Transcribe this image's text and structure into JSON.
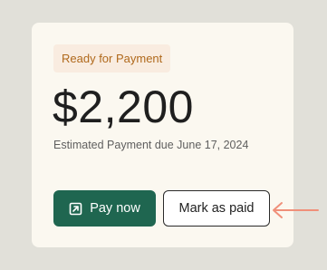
{
  "card": {
    "status_badge": "Ready for Payment",
    "amount": "$2,200",
    "due_text": "Estimated Payment due June 17, 2024",
    "pay_button": {
      "label": "Pay now",
      "icon": "external-link-icon"
    },
    "mark_paid_button": {
      "label": "Mark as paid"
    }
  },
  "annotation": {
    "icon": "arrow-left-icon",
    "color": "#f0907a"
  },
  "colors": {
    "background": "#e1e0d9",
    "card": "#fbf8f0",
    "badge_bg": "#f9ece0",
    "badge_text": "#b0691c",
    "primary": "#1f6650"
  }
}
